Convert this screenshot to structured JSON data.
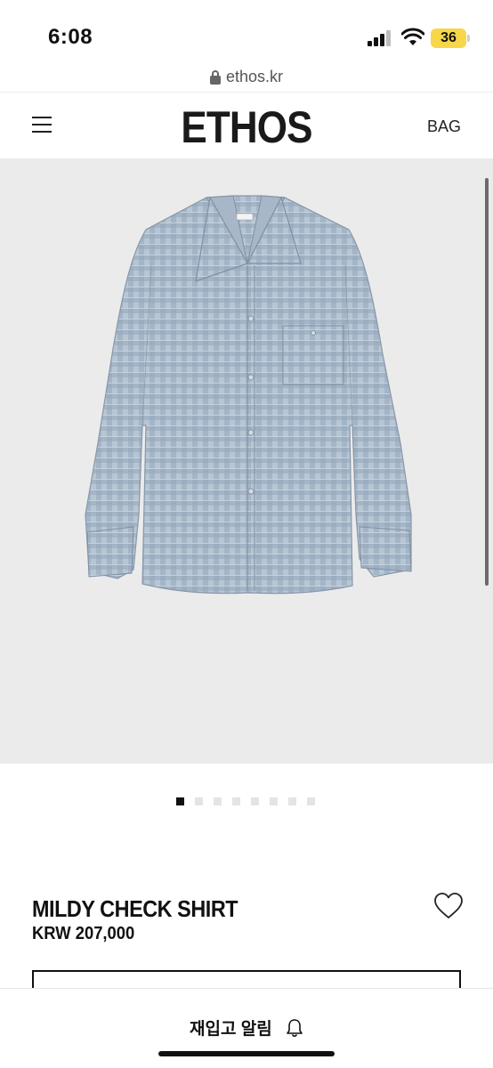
{
  "status_bar": {
    "time": "6:08",
    "battery": "36",
    "icons": [
      "signal-icon",
      "wifi-icon",
      "battery-icon"
    ]
  },
  "browser": {
    "url": "ethos.kr",
    "lock_icon": "lock-icon"
  },
  "header": {
    "menu_icon": "hamburger-menu-icon",
    "logo": "ETHOS",
    "bag_label": "BAG"
  },
  "gallery": {
    "image": "light blue gingham check shirt",
    "total_slides": 8,
    "active_slide": 1
  },
  "product": {
    "name": "MILDY CHECK SHIRT",
    "price": "KRW 207,000",
    "wishlist_icon": "heart-icon"
  },
  "bottom_bar": {
    "restock_label": "재입고 알림",
    "bell_icon": "bell-icon"
  },
  "colors": {
    "accent": "#111111",
    "image_bg": "#ebebeb",
    "shirt_base": "#a9bacb",
    "battery": "#f7d64a"
  }
}
